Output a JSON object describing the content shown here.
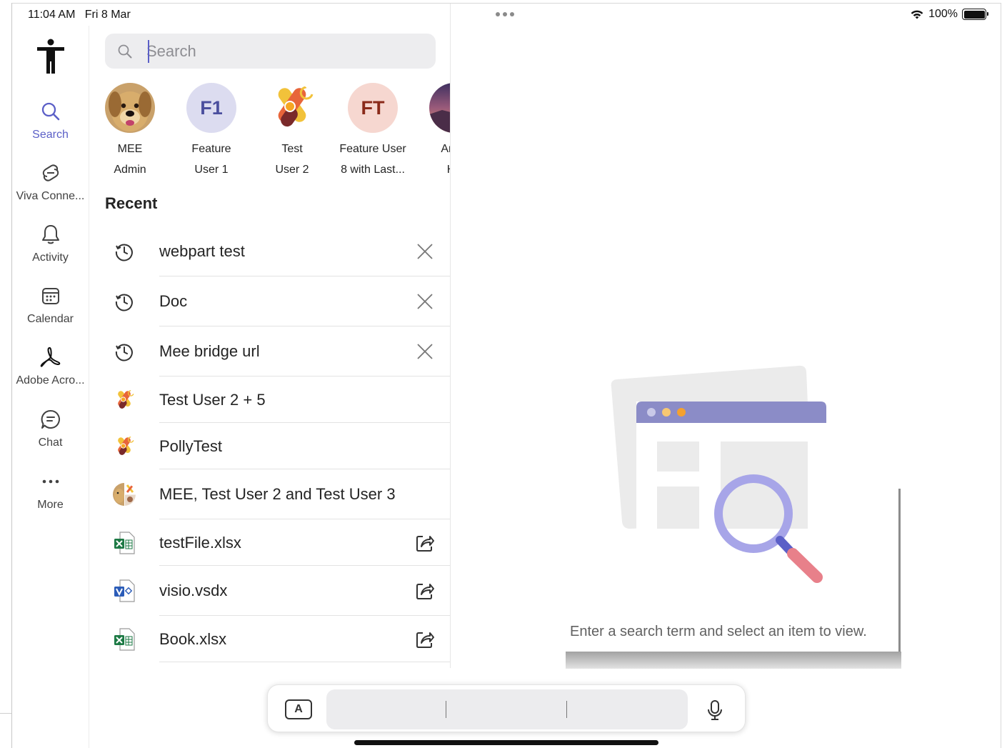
{
  "status_bar": {
    "time": "11:04 AM",
    "date": "Fri 8 Mar",
    "battery": "100%"
  },
  "colors": {
    "accent": "#5b5fc7",
    "rail_text": "#424242",
    "primary_text": "#242424",
    "secondary_text": "#616161"
  },
  "rail": {
    "items": [
      {
        "label": "Search",
        "icon": "search-icon",
        "active": true
      },
      {
        "label": "Viva Conne...",
        "icon": "viva-connections-icon"
      },
      {
        "label": "Activity",
        "icon": "bell-icon"
      },
      {
        "label": "Calendar",
        "icon": "calendar-icon"
      },
      {
        "label": "Adobe Acro...",
        "icon": "adobe-acrobat-icon"
      },
      {
        "label": "Chat",
        "icon": "chat-icon"
      },
      {
        "label": "More",
        "icon": "more-icon"
      }
    ]
  },
  "search": {
    "placeholder": "Search",
    "value": ""
  },
  "people": [
    {
      "name": "MEE\nAdmin",
      "avatar": "dog-photo"
    },
    {
      "name": "Feature\nUser 1",
      "initials": "F1"
    },
    {
      "name": "Test\nUser 2",
      "avatar": "app-logo"
    },
    {
      "name": "Feature User\n8 with Last...",
      "initials": "FT"
    },
    {
      "name": "Aniru\nHa",
      "avatar": "sunset-photo"
    }
  ],
  "recent": {
    "heading": "Recent",
    "items": [
      {
        "label": "webpart test",
        "icon": "history-icon",
        "action": "remove-icon"
      },
      {
        "label": "Doc",
        "icon": "history-icon",
        "action": "remove-icon"
      },
      {
        "label": "Mee bridge url",
        "icon": "history-icon",
        "action": "remove-icon"
      },
      {
        "label": "Test User 2 + 5",
        "icon": "group-chat-icon"
      },
      {
        "label": "PollyTest",
        "icon": "group-chat-icon"
      },
      {
        "label": "MEE, Test User 2 and Test User 3",
        "icon": "group-avatar-icon"
      },
      {
        "label": "testFile.xlsx",
        "icon": "excel-file-icon",
        "action": "share-icon"
      },
      {
        "label": "visio.vsdx",
        "icon": "visio-file-icon",
        "action": "share-icon"
      },
      {
        "label": "Book.xlsx",
        "icon": "excel-file-icon",
        "action": "share-icon"
      }
    ]
  },
  "empty_state": {
    "message": "Enter a search term and select an item to view."
  },
  "dictation": {
    "keyboard_label": "A"
  }
}
